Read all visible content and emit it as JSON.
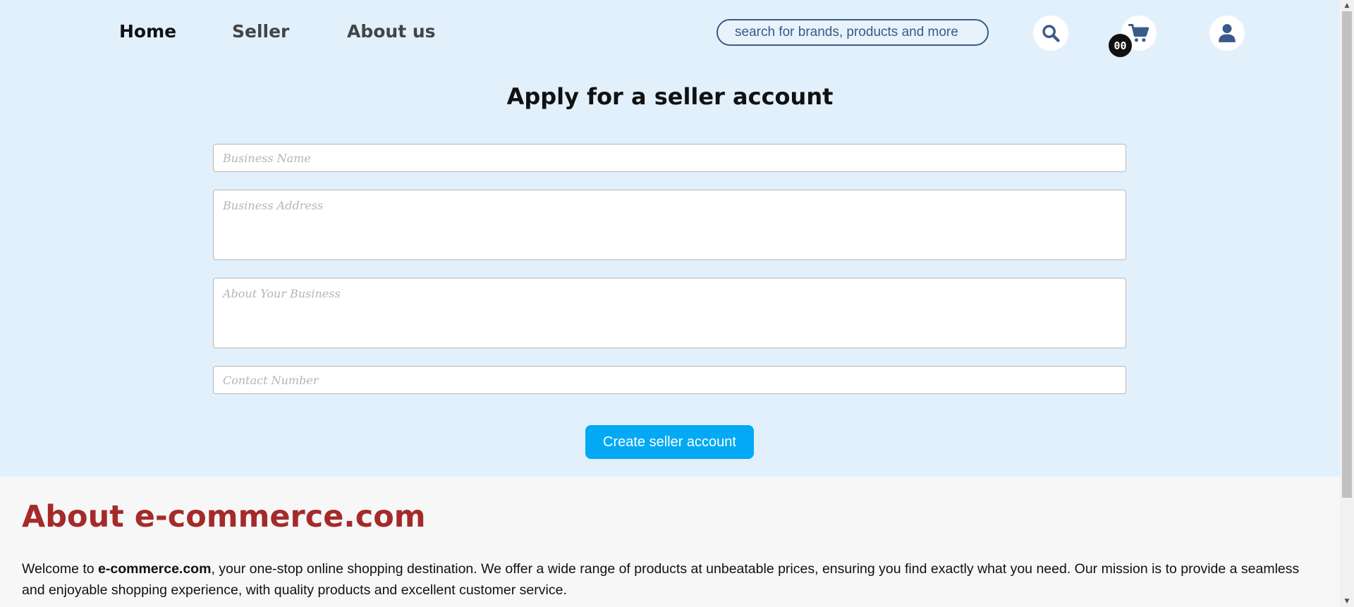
{
  "nav": {
    "home": "Home",
    "seller": "Seller",
    "about": "About us"
  },
  "search": {
    "placeholder": "search for brands, products and more"
  },
  "icons": {
    "search": "search-icon",
    "cart": "cart-icon",
    "user": "user-icon"
  },
  "cart": {
    "count": "00"
  },
  "form": {
    "title": "Apply for a seller account",
    "business_name_placeholder": "Business Name",
    "business_address_placeholder": "Business Address",
    "about_business_placeholder": "About Your Business",
    "contact_number_placeholder": "Contact Number",
    "submit_label": "Create seller account"
  },
  "about": {
    "title": "About e-commerce.com",
    "intro": "Welcome to ",
    "brand": "e-commerce.com",
    "body": ", your one-stop online shopping destination. We offer a wide range of products at unbeatable prices, ensuring you find exactly what you need. Our mission is to provide a seamless and enjoyable shopping experience, with quality products and excellent customer service."
  },
  "colors": {
    "accent": "#03a9f4",
    "header_bg": "#e2f0fc",
    "about_title": "#a52a2a",
    "icon_blue": "#3a5a8a"
  }
}
